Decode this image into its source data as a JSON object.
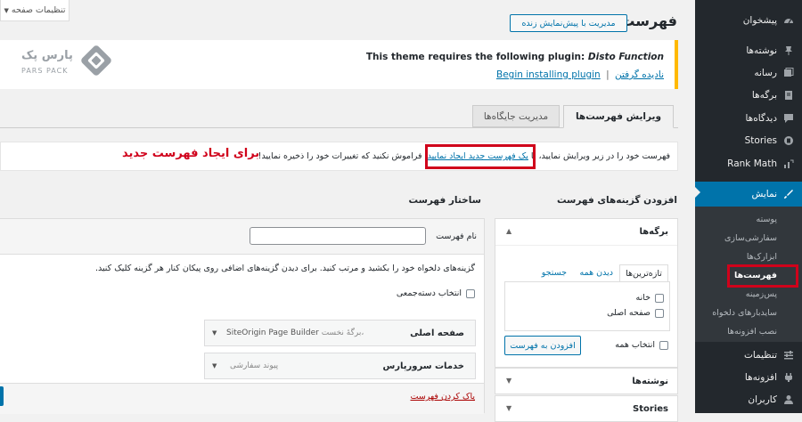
{
  "sidebar": {
    "items": [
      {
        "label": "پیشخوان",
        "icon": "dashboard-icon"
      },
      {
        "label": "نوشته‌ها",
        "icon": "pin-icon"
      },
      {
        "label": "رسانه",
        "icon": "media-icon"
      },
      {
        "label": "برگه‌ها",
        "icon": "page-icon"
      },
      {
        "label": "دیدگاه‌ها",
        "icon": "comment-icon"
      },
      {
        "label": "Stories",
        "icon": "stories-icon"
      },
      {
        "label": "Rank Math",
        "icon": "rank-math-icon"
      },
      {
        "label": "نمایش",
        "icon": "appearance-icon"
      },
      {
        "label": "تنظیمات",
        "icon": "settings-icon"
      },
      {
        "label": "افزونه‌ها",
        "icon": "plugins-icon"
      },
      {
        "label": "کاربران",
        "icon": "users-icon"
      }
    ],
    "submenu": [
      "پوسته",
      "سفارشی‌سازی",
      "ابزارک‌ها",
      "فهرست‌ها",
      "پس‌زمینه",
      "سایدبارهای دلخواه",
      "نصب افزونه‌ها"
    ]
  },
  "screen_options": "تنظیمات صفحه",
  "page_title": "فهرست‌ها",
  "live_preview_button": "مدیریت با پیش‌نمایش زنده",
  "notice": {
    "text_prefix": "This theme requires the following plugin: ",
    "plugin_name": "Disto Function",
    "begin_link": "Begin installing plugin",
    "separator": "|",
    "dismiss_link": "نادیده گرفتن"
  },
  "logo": {
    "text_fa": "پارس پک",
    "text_en": "PARS PACK"
  },
  "tabs": {
    "edit": "ویرایش فهرست‌ها",
    "locations": "مدیریت جایگاه‌ها"
  },
  "instruction": {
    "part1": "فهرست خود را در زیر ویرایش نمایید، یا ",
    "link": "یک فهرست جدید ایجاد نمایید",
    "part2": ". فراموش نکنید که تغییرات خود را ذخیره نمایید!",
    "annotation": "برای ایجاد فهرست جدید"
  },
  "add_items": {
    "heading": "افزودن گزینه‌های فهرست",
    "pages_box": "برگه‌ها",
    "inner_tabs": [
      "تازه‌ترین‌ها",
      "دیدن همه",
      "جستجو"
    ],
    "items": [
      "خانه",
      "صفحه اصلی"
    ],
    "select_all": "انتخاب همه",
    "add_button": "افزودن به فهرست",
    "posts_box": "نوشته‌ها",
    "stories_box": "Stories"
  },
  "structure": {
    "heading": "ساختار فهرست",
    "menu_name_label": "نام فهرست",
    "menu_name_value": "",
    "help": "گزینه‌های دلخواه خود را بکشید و مرتب کنید. برای دیدن گزینه‌های اضافی روی پیکان کنار هر گزینه کلیک کنید.",
    "bulk_select": "انتخاب دسته‌جمعی",
    "items": [
      {
        "title": "صفحه اصلی",
        "type": "SiteOrigin Page Builder",
        "subtype": "برگهٔ نخست،"
      },
      {
        "title": "خدمات سرورپارس",
        "type": "",
        "subtype": "پیوند سفارشی"
      }
    ],
    "delete_link": "پاک کردن فهرست"
  },
  "colors": {
    "accent": "#0073aa",
    "annotation_red": "#d0021b"
  }
}
